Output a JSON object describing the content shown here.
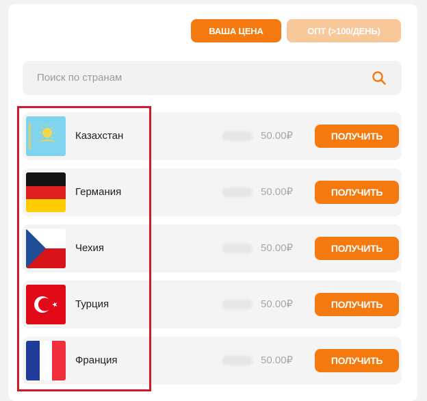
{
  "header": {
    "price_button": "ВАША ЦЕНА",
    "opt_button": "ОПТ (>100/ДЕНЬ)"
  },
  "search": {
    "placeholder": "Поиск по странам",
    "icon": "search-icon"
  },
  "countries": [
    {
      "name": "Казахстан",
      "price": "50.00₽",
      "button": "ПОЛУЧИТЬ",
      "flag": "kazakhstan-flag-icon"
    },
    {
      "name": "Германия",
      "price": "50.00₽",
      "button": "ПОЛУЧИТЬ",
      "flag": "germany-flag-icon"
    },
    {
      "name": "Чехия",
      "price": "50.00₽",
      "button": "ПОЛУЧИТЬ",
      "flag": "czech-flag-icon"
    },
    {
      "name": "Турция",
      "price": "50.00₽",
      "button": "ПОЛУЧИТЬ",
      "flag": "turkey-flag-icon"
    },
    {
      "name": "Франция",
      "price": "50.00₽",
      "button": "ПОЛУЧИТЬ",
      "flag": "france-flag-icon"
    }
  ],
  "colors": {
    "accent": "#f47a10",
    "accent_light": "#f8c79a",
    "highlight_border": "#d4172b"
  }
}
